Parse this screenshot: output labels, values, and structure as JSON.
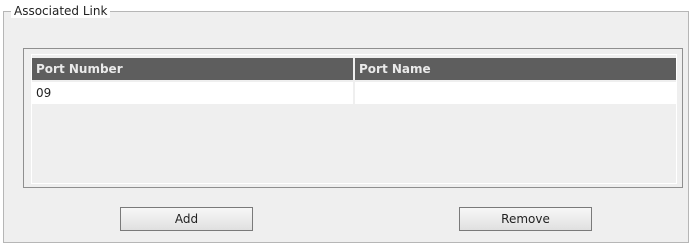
{
  "group": {
    "title": "Associated Link"
  },
  "table": {
    "columns": [
      "Port Number",
      "Port Name"
    ],
    "rows": [
      [
        "09",
        ""
      ]
    ]
  },
  "buttons": {
    "add_label": "Add",
    "remove_label": "Remove"
  }
}
